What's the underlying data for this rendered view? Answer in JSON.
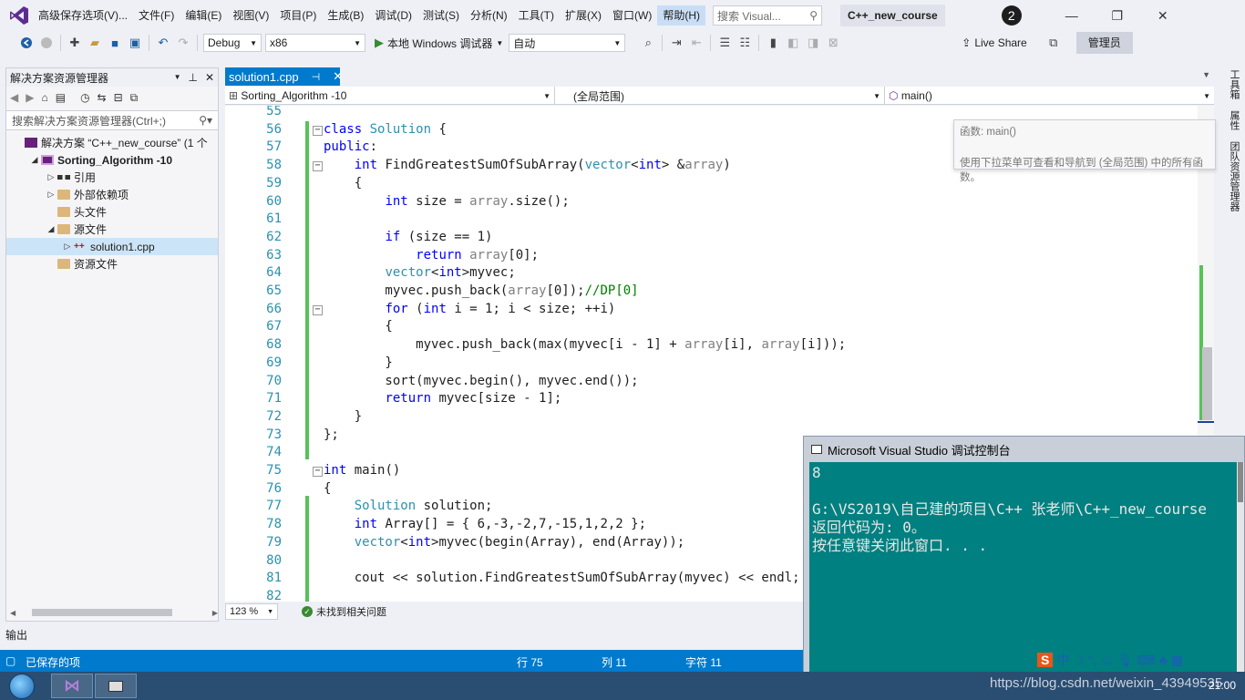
{
  "menu": {
    "items": [
      "高级保存选项(V)...",
      "文件(F)",
      "编辑(E)",
      "视图(V)",
      "项目(P)",
      "生成(B)",
      "调试(D)",
      "测试(S)",
      "分析(N)",
      "工具(T)",
      "扩展(X)",
      "窗口(W)",
      "帮助(H)"
    ],
    "active_index": 12,
    "search_placeholder": "搜索 Visual...",
    "solution_title": "C++_new_course",
    "notification_count": "2"
  },
  "toolbar": {
    "config": "Debug",
    "platform": "x86",
    "run_label": "本地 Windows 调试器",
    "auto": "自动",
    "live_share": "Live Share",
    "admin": "管理员"
  },
  "solution_explorer": {
    "title": "解决方案资源管理器",
    "search_placeholder": "搜索解决方案资源管理器(Ctrl+;)",
    "items": [
      {
        "label": "解决方案 “C++_new_course” (1 个",
        "depth": 0,
        "arrow": "",
        "icon": "vs"
      },
      {
        "label": "Sorting_Algorithm -10",
        "depth": 1,
        "arrow": "◢",
        "icon": "project",
        "bold": true
      },
      {
        "label": "引用",
        "depth": 2,
        "arrow": "▷",
        "icon": "ref"
      },
      {
        "label": "外部依赖项",
        "depth": 2,
        "arrow": "▷",
        "icon": "folder"
      },
      {
        "label": "头文件",
        "depth": 2,
        "arrow": "",
        "icon": "folder"
      },
      {
        "label": "源文件",
        "depth": 2,
        "arrow": "◢",
        "icon": "folder"
      },
      {
        "label": "solution1.cpp",
        "depth": 3,
        "arrow": "▷",
        "icon": "cpp",
        "selected": true
      },
      {
        "label": "资源文件",
        "depth": 2,
        "arrow": "",
        "icon": "folder"
      }
    ]
  },
  "editor": {
    "tab_label": "solution1.cpp",
    "nav_project": "Sorting_Algorithm -10",
    "nav_scope": "(全局范围)",
    "nav_member": "main()",
    "tooltip_title": "函数: main()",
    "tooltip_text": "使用下拉菜单可查看和导航到 (全局范围) 中的所有函数。",
    "zoom": "123 %",
    "issues": "未找到相关问题",
    "lines": [
      {
        "n": "55",
        "code": ""
      },
      {
        "n": "56",
        "code": "class Solution {"
      },
      {
        "n": "57",
        "code": "public:"
      },
      {
        "n": "58",
        "code": "    int FindGreatestSumOfSubArray(vector<int> &array)"
      },
      {
        "n": "59",
        "code": "    {"
      },
      {
        "n": "60",
        "code": "        int size = array.size();"
      },
      {
        "n": "61",
        "code": ""
      },
      {
        "n": "62",
        "code": "        if (size == 1)"
      },
      {
        "n": "63",
        "code": "            return array[0];"
      },
      {
        "n": "64",
        "code": "        vector<int>myvec;"
      },
      {
        "n": "65",
        "code": "        myvec.push_back(array[0]);//DP[0]"
      },
      {
        "n": "66",
        "code": "        for (int i = 1; i < size; ++i)"
      },
      {
        "n": "67",
        "code": "        {"
      },
      {
        "n": "68",
        "code": "            myvec.push_back(max(myvec[i - 1] + array[i], array[i]));"
      },
      {
        "n": "69",
        "code": "        }"
      },
      {
        "n": "70",
        "code": "        sort(myvec.begin(), myvec.end());"
      },
      {
        "n": "71",
        "code": "        return myvec[size - 1];"
      },
      {
        "n": "72",
        "code": "    }"
      },
      {
        "n": "73",
        "code": "};"
      },
      {
        "n": "74",
        "code": ""
      },
      {
        "n": "75",
        "code": "int main()"
      },
      {
        "n": "76",
        "code": "{"
      },
      {
        "n": "77",
        "code": "    Solution solution;"
      },
      {
        "n": "78",
        "code": "    int Array[] = { 6,-3,-2,7,-15,1,2,2 };"
      },
      {
        "n": "79",
        "code": "    vector<int>myvec(begin(Array), end(Array));"
      },
      {
        "n": "80",
        "code": ""
      },
      {
        "n": "81",
        "code": "    cout << solution.FindGreatestSumOfSubArray(myvec) << endl;"
      },
      {
        "n": "82",
        "code": ""
      }
    ]
  },
  "right_tabs": [
    "工具箱",
    "属性",
    "团队资源管理器"
  ],
  "output": {
    "label": "输出"
  },
  "statusbar": {
    "saved": "已保存的项",
    "row": "行 75",
    "col": "列 11",
    "char": "字符 11"
  },
  "console": {
    "title": "Microsoft Visual Studio 调试控制台",
    "lines": [
      "8",
      "",
      "G:\\VS2019\\自己建的项目\\C++ 张老师\\C++_new_course",
      "返回代码为: 0。",
      "按任意键关闭此窗口. . ."
    ]
  },
  "taskbar": {
    "clock": "21:00",
    "watermark": "https://blog.csdn.net/weixin_43949535"
  }
}
